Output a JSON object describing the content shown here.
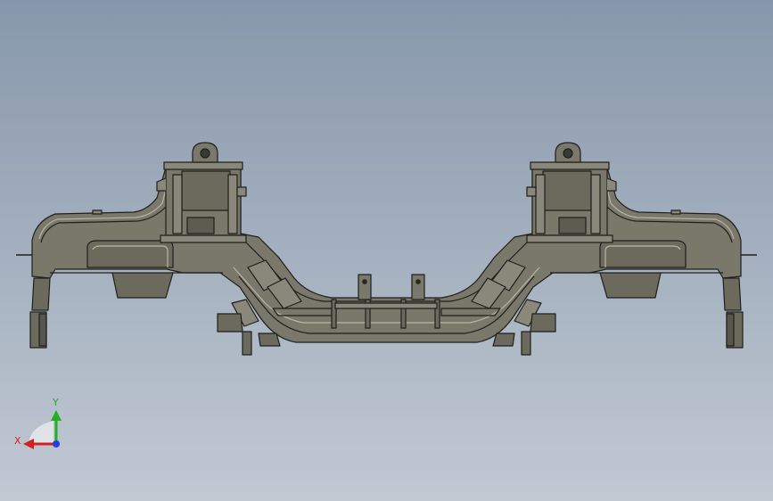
{
  "viewport": {
    "background_top": "#8797ab",
    "background_bottom": "#c1c9d3"
  },
  "model": {
    "fill": "#7a786a",
    "fill_dark": "#5e5c50",
    "edge": "#1f1f1c",
    "highlight": "#b8b6a6"
  },
  "triad": {
    "x_label": "X",
    "y_label": "Y",
    "x_color": "#d42020",
    "y_color": "#22b022",
    "z_color": "#2040e0"
  }
}
